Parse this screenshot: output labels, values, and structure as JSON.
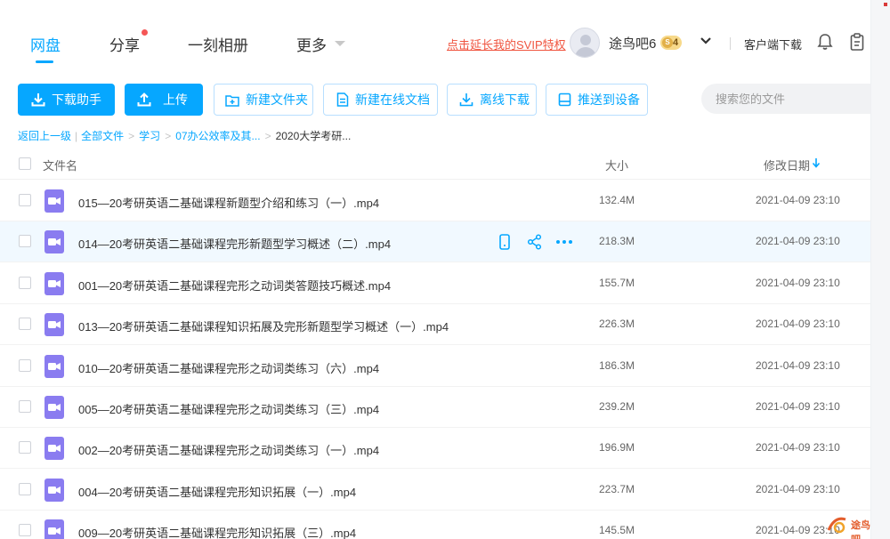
{
  "nav": {
    "tabs": [
      {
        "label": "网盘",
        "active": true
      },
      {
        "label": "分享",
        "active": false,
        "has_dot": true
      },
      {
        "label": "一刻相册",
        "active": false
      },
      {
        "label": "更多",
        "active": false
      }
    ],
    "svip_link": "点击延长我的SVIP特权",
    "username": "途鸟吧6",
    "vip_level": "4",
    "client_download": "客户端下载",
    "icons": [
      "avatar",
      "chevron-down-icon",
      "bell-icon",
      "clipboard-icon"
    ]
  },
  "toolbar": {
    "download_helper": "下载助手",
    "upload": "上传",
    "new_folder": "新建文件夹",
    "new_online_doc": "新建在线文档",
    "offline_download": "离线下载",
    "push_to_device": "推送到设备",
    "search_placeholder": "搜索您的文件"
  },
  "breadcrumb": {
    "back": "返回上一级",
    "all_files": "全部文件",
    "level1": "学习",
    "level2": "07办公效率及其...",
    "current": "2020大学考研..."
  },
  "table": {
    "headers": {
      "name": "文件名",
      "size": "大小",
      "modified": "修改日期"
    },
    "sort": "modified-desc",
    "rows": [
      {
        "name": "015—20考研英语二基础课程新题型介绍和练习（一）.mp4",
        "size": "132.4M",
        "date": "2021-04-09 23:10"
      },
      {
        "name": "014—20考研英语二基础课程完形新题型学习概述（二）.mp4",
        "size": "218.3M",
        "date": "2021-04-09 23:10",
        "hover": true
      },
      {
        "name": "001—20考研英语二基础课程完形之动词类答题技巧概述.mp4",
        "size": "155.7M",
        "date": "2021-04-09 23:10"
      },
      {
        "name": "013—20考研英语二基础课程知识拓展及完形新题型学习概述（一）.mp4",
        "size": "226.3M",
        "date": "2021-04-09 23:10"
      },
      {
        "name": "010—20考研英语二基础课程完形之动词类练习（六）.mp4",
        "size": "186.3M",
        "date": "2021-04-09 23:10"
      },
      {
        "name": "005—20考研英语二基础课程完形之动词类练习（三）.mp4",
        "size": "239.2M",
        "date": "2021-04-09 23:10"
      },
      {
        "name": "002—20考研英语二基础课程完形之动词类练习（一）.mp4",
        "size": "196.9M",
        "date": "2021-04-09 23:10"
      },
      {
        "name": "004—20考研英语二基础课程完形知识拓展（一）.mp4",
        "size": "223.7M",
        "date": "2021-04-09 23:10"
      },
      {
        "name": "009—20考研英语二基础课程完形知识拓展（三）.mp4",
        "size": "145.5M",
        "date": "2021-04-09 23:10"
      }
    ]
  },
  "watermark": "途鸟吧",
  "colors": {
    "accent": "#06a7ff",
    "link_red": "#f05540",
    "video_icon": "#8a7cf0",
    "hover_row": "#f1f9ff"
  }
}
